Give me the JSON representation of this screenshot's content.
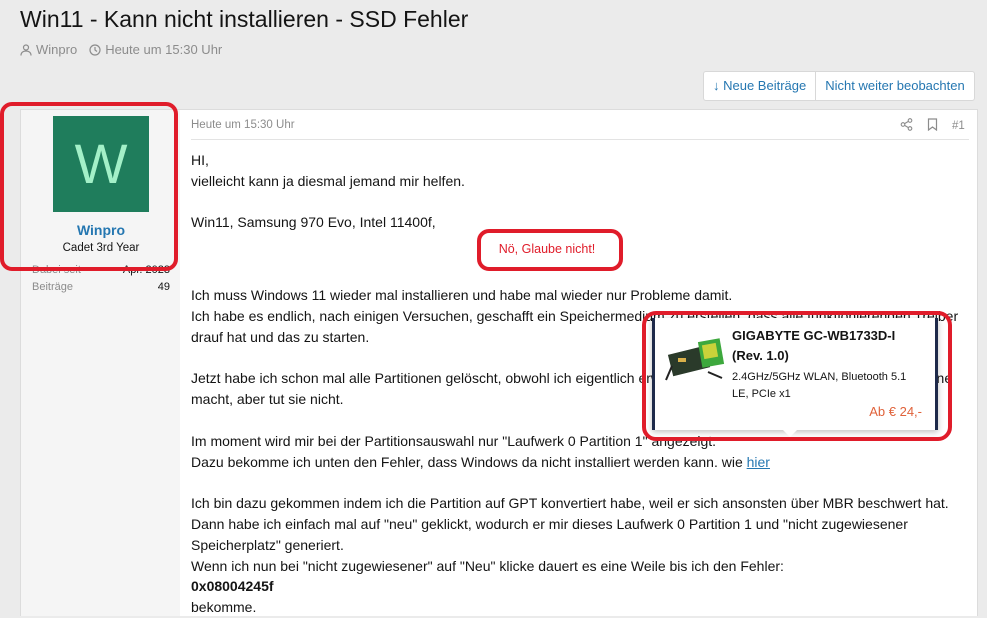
{
  "thread": {
    "title": "Win11 - Kann nicht installieren - SSD Fehler",
    "author": "Winpro",
    "time": "Heute um 15:30 Uhr"
  },
  "toolbar": {
    "new_posts": "↓ Neue Beiträge",
    "unwatch": "Nicht weiter beobachten"
  },
  "user": {
    "avatar_letter": "W",
    "name": "Winpro",
    "title": "Cadet 3rd Year",
    "stats": [
      {
        "label": "Dabei seit",
        "value": "Apr. 2023"
      },
      {
        "label": "Beiträge",
        "value": "49"
      }
    ]
  },
  "post": {
    "date": "Heute um 15:30 Uhr",
    "number": "#1",
    "lines": {
      "l1": "HI,",
      "l2": "vielleicht kann ja diesmal jemand mir helfen.",
      "l3": "Win11, Samsung 970 Evo, Intel 11400f,",
      "l4": "Ich muss Windows 11 wieder mal installieren und habe mal wieder nur Probleme damit.",
      "l5": "Ich habe es endlich, nach einigen Versuchen, geschafft ein Speichermedium zu erstellen, dass alle funktionierenden Treiber drauf hat und das zu starten.",
      "l6": "Jetzt habe ich schon mal alle Partitionen gelöscht, obwohl ich eigentlich erwartet hatte, dass die Installation das von alleine macht, aber tut sie nicht.",
      "l7": "Im moment wird mir bei der Partitionsauswahl nur \"Laufwerk 0 Partition 1\" angezeigt.",
      "l8_pre": "Dazu bekomme ich unten den Fehler, dass Windows da nicht installiert werden kann. wie ",
      "l8_link": "hier",
      "l9": "Ich bin dazu gekommen indem ich die Partition auf GPT konvertiert habe, weil er sich ansonsten über MBR beschwert hat. Dann habe ich einfach mal auf \"neu\" geklickt, wodurch er mir dieses Laufwerk 0 Partition 1 und \"nicht zugewiesener Speicherplatz\" generiert.",
      "l10": "Wenn ich nun bei \"nicht zugewiesener\" auf \"Neu\" klicke dauert es eine Weile bis ich den Fehler:",
      "l11": "0x08004245f",
      "l12": "bekomme."
    }
  },
  "annotation": {
    "text": "Nö, Glaube nicht!"
  },
  "tooltip": {
    "title": "GIGABYTE GC-WB1733D-I (Rev. 1.0)",
    "desc": "2.4GHz/5GHz WLAN, Bluetooth 5.1 LE, PCIe x1",
    "price": "Ab € 24,-"
  },
  "colors": {
    "accent": "#2577b1",
    "annotation": "#e01c2a",
    "price": "#e0623a",
    "avatar_bg": "#1f7d5c"
  }
}
